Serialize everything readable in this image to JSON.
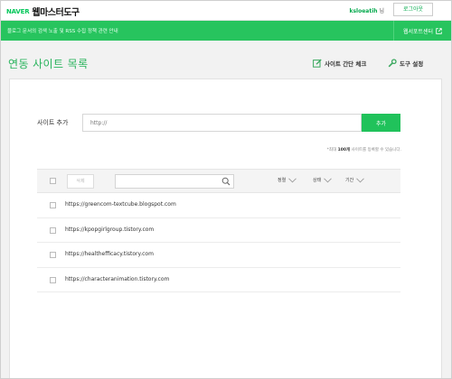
{
  "header": {
    "brand": "NAVER",
    "service": "웹마스터도구",
    "user_id": "ksloeatih",
    "user_suffix": "님",
    "logout_label": "로그아웃"
  },
  "banner": {
    "notice": "블로그 문서의 검색 노출 및 RSS 수집 정책 관련 안내",
    "support_label": "웹서포트센터"
  },
  "page": {
    "title": "연동 사이트 목록",
    "check_label": "사이트 간단 체크",
    "settings_label": "도구 설정"
  },
  "add_site": {
    "label": "사이트 추가",
    "placeholder": "http://",
    "button": "추가",
    "hint_prefix": "*최대",
    "hint_count": "100개",
    "hint_suffix": "사이트를 등록할 수 있습니다."
  },
  "toolbar": {
    "delete_label": "삭제",
    "sort_labels": [
      "정렬",
      "상태",
      "기간"
    ]
  },
  "sites": [
    "https://greencom-textcube.blogspot.com",
    "https://kpopgirlgroup.tistory.com",
    "https://healthefficacy.tistory.com",
    "https://characteranimation.tistory.com"
  ],
  "colors": {
    "brand_green": "#03c75a",
    "banner_green": "#27c45e",
    "title_green": "#27b35b"
  },
  "icons": [
    "external-link-icon",
    "check-edit-icon",
    "wrench-icon",
    "search-icon",
    "chevron-down-icon"
  ]
}
